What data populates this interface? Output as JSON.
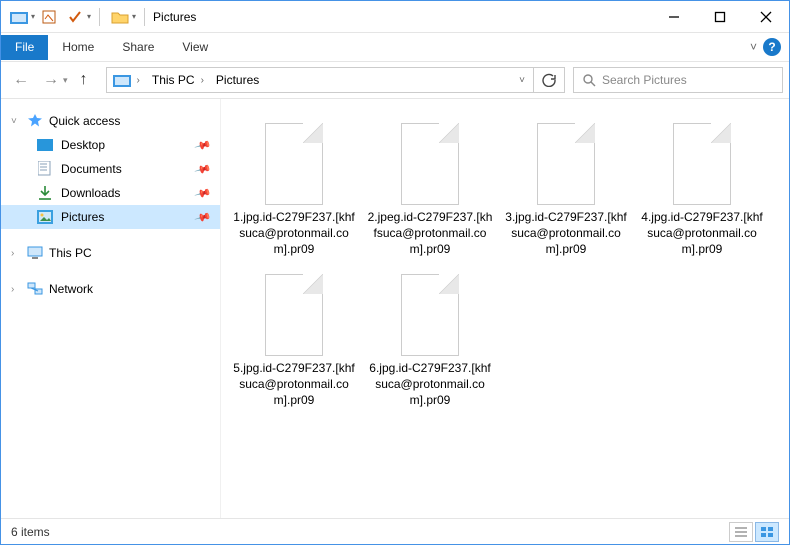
{
  "window": {
    "title": "Pictures"
  },
  "ribbon": {
    "file": "File",
    "tabs": [
      "Home",
      "Share",
      "View"
    ]
  },
  "breadcrumb": {
    "items": [
      "This PC",
      "Pictures"
    ]
  },
  "search": {
    "placeholder": "Search Pictures"
  },
  "sidebar": {
    "quick_access": {
      "label": "Quick access",
      "items": [
        {
          "label": "Desktop"
        },
        {
          "label": "Documents"
        },
        {
          "label": "Downloads"
        },
        {
          "label": "Pictures",
          "selected": true
        }
      ]
    },
    "this_pc": {
      "label": "This PC"
    },
    "network": {
      "label": "Network"
    }
  },
  "files": [
    {
      "name": "1.jpg.id-C279F237.[khfsuca@protonmail.com].pr09"
    },
    {
      "name": "2.jpeg.id-C279F237.[khfsuca@protonmail.com].pr09"
    },
    {
      "name": "3.jpg.id-C279F237.[khfsuca@protonmail.com].pr09"
    },
    {
      "name": "4.jpg.id-C279F237.[khfsuca@protonmail.com].pr09"
    },
    {
      "name": "5.jpg.id-C279F237.[khfsuca@protonmail.com].pr09"
    },
    {
      "name": "6.jpg.id-C279F237.[khfsuca@protonmail.com].pr09"
    }
  ],
  "status": {
    "count_label": "6 items"
  }
}
